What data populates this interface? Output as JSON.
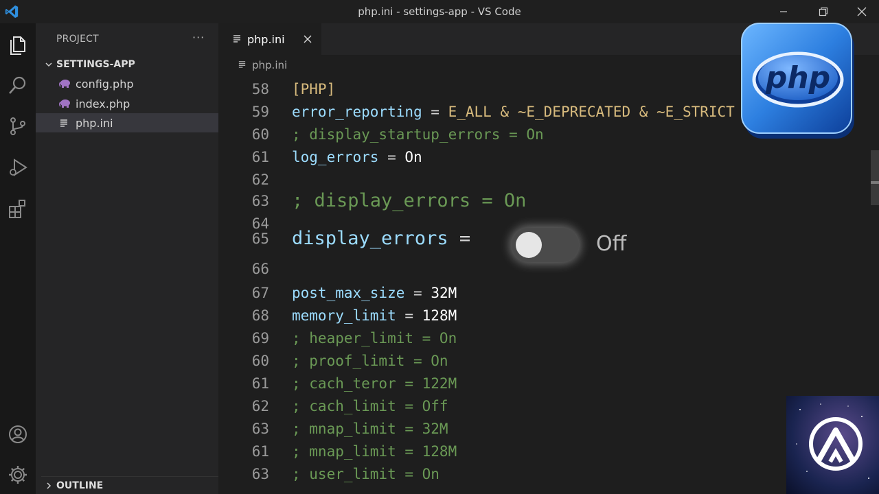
{
  "window": {
    "title": "php.ini - settings-app - VS Code",
    "controls": [
      "minimize",
      "restore",
      "close"
    ]
  },
  "sidebar": {
    "header": "PROJECT",
    "more": "···",
    "folder": "SETTINGS-APP",
    "files": [
      {
        "name": "config.php",
        "icon": "php-elephant-icon"
      },
      {
        "name": "index.php",
        "icon": "php-elephant-icon"
      },
      {
        "name": "php.ini",
        "icon": "lines-file-icon",
        "selected": true
      }
    ],
    "outline": "OUTLINE"
  },
  "editor": {
    "tab": {
      "label": "php.ini"
    },
    "breadcrumb": "php.ini",
    "lines": [
      {
        "n": "58",
        "parts": [
          [
            "s",
            "[PHP]"
          ]
        ]
      },
      {
        "n": "59",
        "parts": [
          [
            "k",
            "error_reporting"
          ],
          [
            "o",
            " = "
          ],
          [
            "s",
            "E_ALL & ~E_DEPRECATED & ~E_STRICT"
          ]
        ]
      },
      {
        "n": "60",
        "parts": [
          [
            "c",
            "; display_startup_errors = On"
          ]
        ]
      },
      {
        "n": "61",
        "parts": [
          [
            "k",
            "log_errors"
          ],
          [
            "o",
            " = "
          ],
          [
            "v",
            "On"
          ]
        ]
      },
      {
        "n": "62",
        "parts": []
      },
      {
        "n": "63",
        "parts": [
          [
            "c",
            "; display_errors = On"
          ]
        ],
        "big": true
      },
      {
        "n": "64",
        "parts": []
      },
      {
        "n": "65",
        "parts": [
          [
            "k",
            "display_errors"
          ],
          [
            "o",
            " ="
          ]
        ],
        "big": true
      },
      {
        "n": "66",
        "parts": []
      },
      {
        "n": "67",
        "parts": [
          [
            "k",
            "post_max_size"
          ],
          [
            "o",
            " = "
          ],
          [
            "v",
            "32M"
          ]
        ]
      },
      {
        "n": "68",
        "parts": [
          [
            "k",
            "memory_limit"
          ],
          [
            "o",
            " = "
          ],
          [
            "v",
            "128M"
          ]
        ]
      },
      {
        "n": "69",
        "parts": [
          [
            "c",
            "; heaper_limit = On"
          ]
        ]
      },
      {
        "n": "60",
        "parts": [
          [
            "c",
            "; proof_limit = On"
          ]
        ]
      },
      {
        "n": "61",
        "parts": [
          [
            "c",
            "; cach_teror = 122M"
          ]
        ]
      },
      {
        "n": "62",
        "parts": [
          [
            "c",
            "; cach_limit = Off"
          ]
        ]
      },
      {
        "n": "63",
        "parts": [
          [
            "c",
            "; mnap_limit = 32M"
          ]
        ]
      },
      {
        "n": "61",
        "parts": [
          [
            "c",
            "; mnap_limit = 128M"
          ]
        ]
      },
      {
        "n": "63",
        "parts": [
          [
            "c",
            "; user_limit = On"
          ]
        ]
      }
    ],
    "toggle": {
      "label": "Off",
      "on": false
    }
  },
  "badge": {
    "text": "php"
  },
  "colors": {
    "accent": "#007acc",
    "key": "#9cdcfe",
    "comment": "#6a9955",
    "section": "#d7ba7d"
  }
}
